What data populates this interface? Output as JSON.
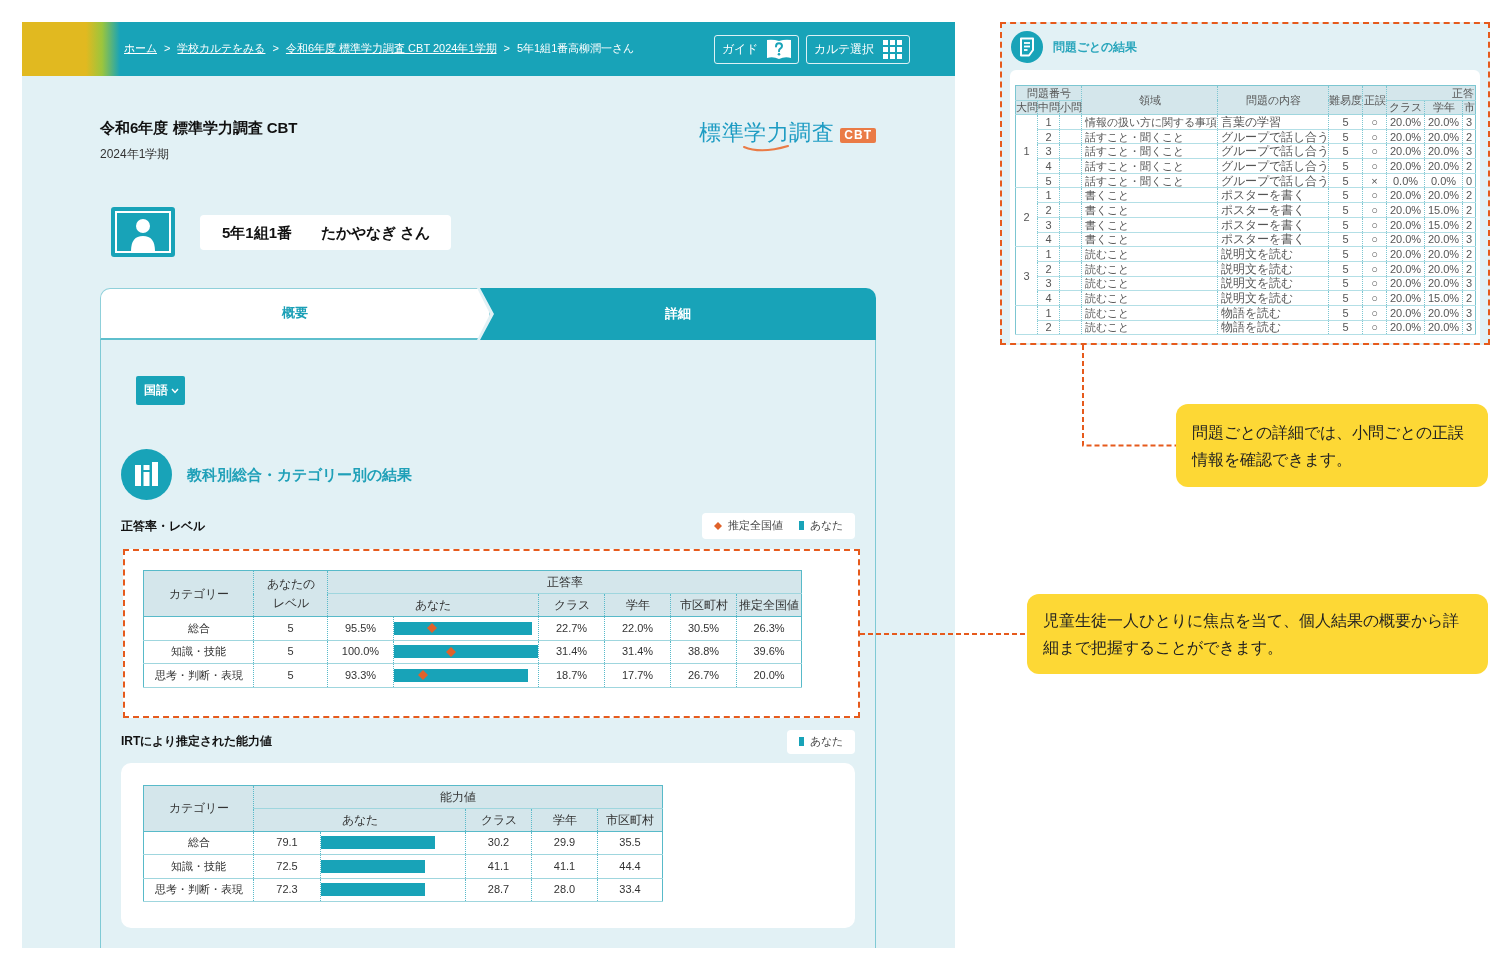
{
  "top_bar": {
    "breadcrumbs": [
      {
        "label": "ホーム",
        "current": false,
        "separator": ">"
      },
      {
        "label": "学校カルテをみる",
        "current": false,
        "separator": ">"
      },
      {
        "label": "令和6年度 標準学力調査 CBT 2024年1学期",
        "current": false,
        "separator": ">"
      },
      {
        "label": "5年1組1番高柳潤一さん",
        "current": true
      }
    ],
    "buttons": [
      {
        "label": "ガイド",
        "kind": "guide"
      },
      {
        "label": "カルテ選択",
        "kind": "grid"
      }
    ]
  },
  "header": {
    "title": "令和6年度 標準学力調査 CBT",
    "term": "2024年1学期",
    "logo": {
      "text": "標準学力調査",
      "badge": "CBT"
    }
  },
  "student": {
    "number": "5年1組1番",
    "name": "たかやなぎ さん"
  },
  "tabs": [
    {
      "label": "概要",
      "selected": true
    },
    {
      "label": "詳細",
      "selected": false
    }
  ],
  "subject_dropdown": {
    "label": "国語"
  },
  "section": {
    "title": "教科別総合・カテゴリー別の結果"
  },
  "accuracy": {
    "title": "正答率・レベル",
    "legend": [
      {
        "kind": "diamond",
        "label": "推定全国値"
      },
      {
        "kind": "bar",
        "label": "あなた"
      }
    ],
    "table": {
      "category_header": "カテゴリー",
      "level_header": "あなたのレベル",
      "group_header": "正答率",
      "columns": [
        "あなた",
        "クラス",
        "学年",
        "市区町村",
        "推定全国値"
      ],
      "rows": [
        {
          "category": "総合",
          "your_level": "5",
          "you": "95.5%",
          "you_bar": {
            "level": 0.955
          },
          "national_marker": {
            "level": 0.263
          },
          "values": [
            "22.7%",
            "22.0%",
            "30.5%",
            "26.3%"
          ]
        },
        {
          "category": "知識・技能",
          "your_level": "5",
          "you": "100.0%",
          "you_bar": {
            "level": 1.0
          },
          "national_marker": {
            "level": 0.396
          },
          "values": [
            "31.4%",
            "31.4%",
            "38.8%",
            "39.6%"
          ]
        },
        {
          "category": "思考・判断・表現",
          "your_level": "5",
          "you": "93.3%",
          "you_bar": {
            "level": 0.933
          },
          "national_marker": {
            "level": 0.2
          },
          "values": [
            "18.7%",
            "17.7%",
            "26.7%",
            "20.0%"
          ]
        }
      ]
    }
  },
  "ability": {
    "title": "IRTにより推定された能力値",
    "legend": [
      {
        "kind": "bar",
        "label": "あなた"
      }
    ],
    "table": {
      "category_header": "カテゴリー",
      "group_header": "能力値",
      "columns": [
        "あなた",
        "クラス",
        "学年",
        "市区町村"
      ],
      "rows": [
        {
          "category": "総合",
          "you": "79.1",
          "you_bar": {
            "level": 0.791
          },
          "values": [
            "30.2",
            "29.9",
            "35.5"
          ]
        },
        {
          "category": "知識・技能",
          "you": "72.5",
          "you_bar": {
            "level": 0.725
          },
          "values": [
            "41.1",
            "41.1",
            "44.4"
          ]
        },
        {
          "category": "思考・判断・表現",
          "you": "72.3",
          "you_bar": {
            "level": 0.723
          },
          "values": [
            "28.7",
            "28.0",
            "33.4"
          ]
        }
      ]
    }
  },
  "question_results": {
    "title": "問題ごとの結果",
    "table": {
      "number_header": "問題番号",
      "number_columns": [
        "大問",
        "中問",
        "小問"
      ],
      "columns": [
        "領域",
        "問題の内容",
        "難易度",
        "正誤"
      ],
      "group_header": "正答",
      "group_columns": [
        "クラス",
        "学年",
        "市"
      ],
      "groups": [
        {
          "major": "1",
          "rows": [
            {
              "middle": "1",
              "domain": "情報の扱い方に関する事項",
              "content": "言葉の学習",
              "difficulty": "5",
              "result": "○",
              "values": [
                "20.0%",
                "20.0%",
                "3"
              ]
            },
            {
              "middle": "2",
              "domain": "話すこと・聞くこと",
              "content": "グループで話し合う",
              "difficulty": "5",
              "result": "○",
              "values": [
                "20.0%",
                "20.0%",
                "2"
              ]
            },
            {
              "middle": "3",
              "domain": "話すこと・聞くこと",
              "content": "グループで話し合う",
              "difficulty": "5",
              "result": "○",
              "values": [
                "20.0%",
                "20.0%",
                "3"
              ]
            },
            {
              "middle": "4",
              "domain": "話すこと・聞くこと",
              "content": "グループで話し合う",
              "difficulty": "5",
              "result": "○",
              "values": [
                "20.0%",
                "20.0%",
                "2"
              ]
            },
            {
              "middle": "5",
              "domain": "話すこと・聞くこと",
              "content": "グループで話し合う",
              "difficulty": "5",
              "result": "×",
              "values": [
                "0.0%",
                "0.0%",
                "0"
              ]
            }
          ]
        },
        {
          "major": "2",
          "rows": [
            {
              "middle": "1",
              "domain": "書くこと",
              "content": "ポスターを書く",
              "difficulty": "5",
              "result": "○",
              "values": [
                "20.0%",
                "20.0%",
                "2"
              ]
            },
            {
              "middle": "2",
              "domain": "書くこと",
              "content": "ポスターを書く",
              "difficulty": "5",
              "result": "○",
              "values": [
                "20.0%",
                "15.0%",
                "2"
              ]
            },
            {
              "middle": "3",
              "domain": "書くこと",
              "content": "ポスターを書く",
              "difficulty": "5",
              "result": "○",
              "values": [
                "20.0%",
                "15.0%",
                "2"
              ]
            },
            {
              "middle": "4",
              "domain": "書くこと",
              "content": "ポスターを書く",
              "difficulty": "5",
              "result": "○",
              "values": [
                "20.0%",
                "20.0%",
                "3"
              ]
            }
          ]
        },
        {
          "major": "3",
          "rows": [
            {
              "middle": "1",
              "domain": "読むこと",
              "content": "説明文を読む",
              "difficulty": "5",
              "result": "○",
              "values": [
                "20.0%",
                "20.0%",
                "2"
              ]
            },
            {
              "middle": "2",
              "domain": "読むこと",
              "content": "説明文を読む",
              "difficulty": "5",
              "result": "○",
              "values": [
                "20.0%",
                "20.0%",
                "2"
              ]
            },
            {
              "middle": "3",
              "domain": "読むこと",
              "content": "説明文を読む",
              "difficulty": "5",
              "result": "○",
              "values": [
                "20.0%",
                "20.0%",
                "3"
              ]
            },
            {
              "middle": "4",
              "domain": "読むこと",
              "content": "説明文を読む",
              "difficulty": "5",
              "result": "○",
              "values": [
                "20.0%",
                "15.0%",
                "2"
              ]
            }
          ]
        },
        {
          "rows": [
            {
              "middle": "1",
              "domain": "読むこと",
              "content": "物語を読む",
              "difficulty": "5",
              "result": "○",
              "values": [
                "20.0%",
                "20.0%",
                "3"
              ]
            },
            {
              "middle": "2",
              "domain": "読むこと",
              "content": "物語を読む",
              "difficulty": "5",
              "result": "○",
              "values": [
                "20.0%",
                "20.0%",
                "3"
              ]
            }
          ]
        }
      ]
    }
  },
  "callouts": [
    {
      "text": "問題ごとの詳細では、小問ごとの正誤情報を確認できます。"
    },
    {
      "text": "児童生徒一人ひとりに焦点を当て、個人結果の概要から詳細まで把握することができます。"
    }
  ]
}
